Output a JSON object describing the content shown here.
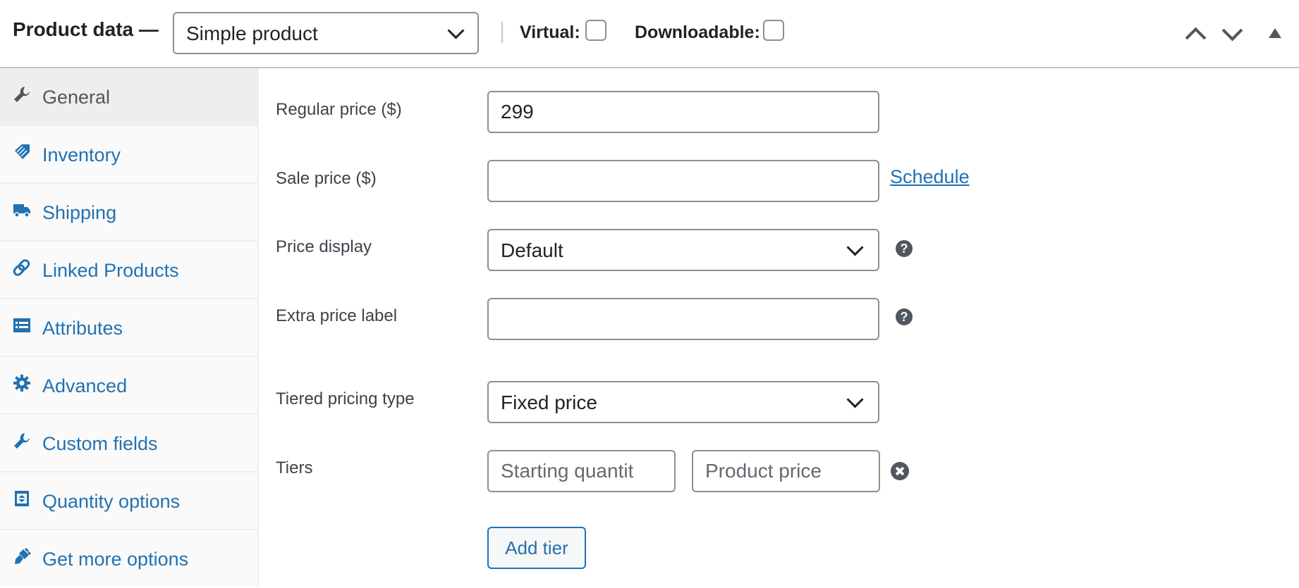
{
  "header": {
    "title": "Product data —",
    "product_type": "Simple product",
    "virtual_label": "Virtual:",
    "downloadable_label": "Downloadable:",
    "virtual_checked": false,
    "downloadable_checked": false
  },
  "sidebar": {
    "items": [
      {
        "label": "General",
        "icon": "wrench-icon",
        "active": true
      },
      {
        "label": "Inventory",
        "icon": "tag-icon"
      },
      {
        "label": "Shipping",
        "icon": "truck-icon"
      },
      {
        "label": "Linked Products",
        "icon": "link-icon"
      },
      {
        "label": "Attributes",
        "icon": "list-icon"
      },
      {
        "label": "Advanced",
        "icon": "gear-icon"
      },
      {
        "label": "Custom fields",
        "icon": "wrench-icon"
      },
      {
        "label": "Quantity options",
        "icon": "quantity-icon"
      },
      {
        "label": "Get more options",
        "icon": "plugin-icon"
      }
    ]
  },
  "general": {
    "regular_price_label": "Regular price ($)",
    "regular_price_value": "299",
    "sale_price_label": "Sale price ($)",
    "sale_price_value": "",
    "schedule_link": "Schedule",
    "price_display_label": "Price display",
    "price_display_value": "Default",
    "extra_price_label": "Extra price label",
    "extra_price_value": "",
    "tiered_pricing_label": "Tiered pricing type",
    "tiered_pricing_value": "Fixed price",
    "tiers_label": "Tiers",
    "starting_quantity_placeholder": "Starting quantit",
    "product_price_placeholder": "Product price",
    "add_tier_label": "Add tier",
    "help_glyph": "?"
  },
  "colors": {
    "link": "#2271b1",
    "icon": "#50575e",
    "border": "#8c8f94"
  }
}
